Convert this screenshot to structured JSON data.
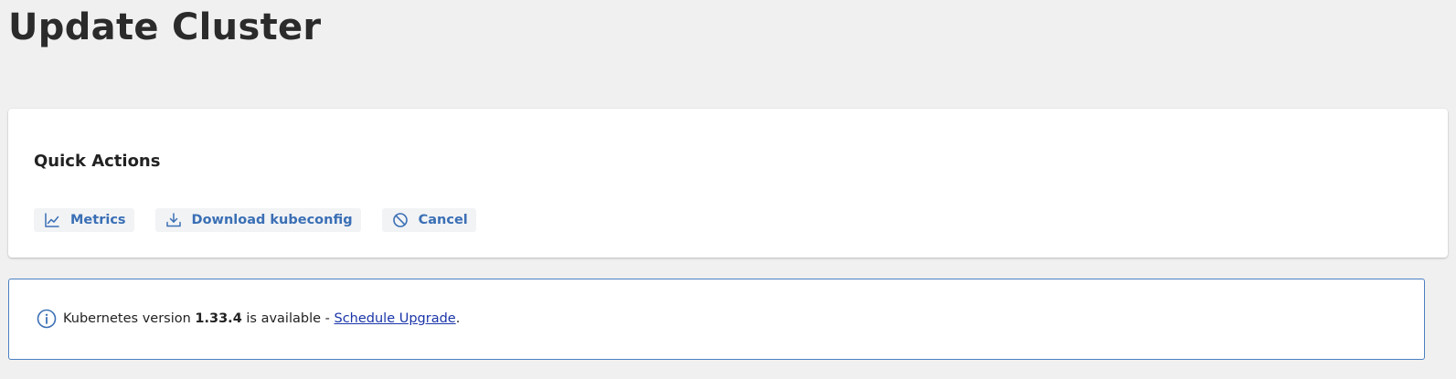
{
  "page": {
    "title": "Update Cluster"
  },
  "quick_actions": {
    "title": "Quick Actions",
    "buttons": [
      {
        "label": "Metrics",
        "icon": "chart-line-icon"
      },
      {
        "label": "Download kubeconfig",
        "icon": "download-icon"
      },
      {
        "label": "Cancel",
        "icon": "ban-icon"
      }
    ]
  },
  "alert": {
    "icon": "info-icon",
    "text_before": "Kubernetes version",
    "version": "1.33.4",
    "text_middle": "is available -",
    "link_label": "Schedule Upgrade",
    "text_after": "."
  },
  "colors": {
    "background": "#f0f0f0",
    "accent": "#3a6fb5",
    "link": "#1a35a8",
    "alert_border": "#4a7fc1"
  }
}
